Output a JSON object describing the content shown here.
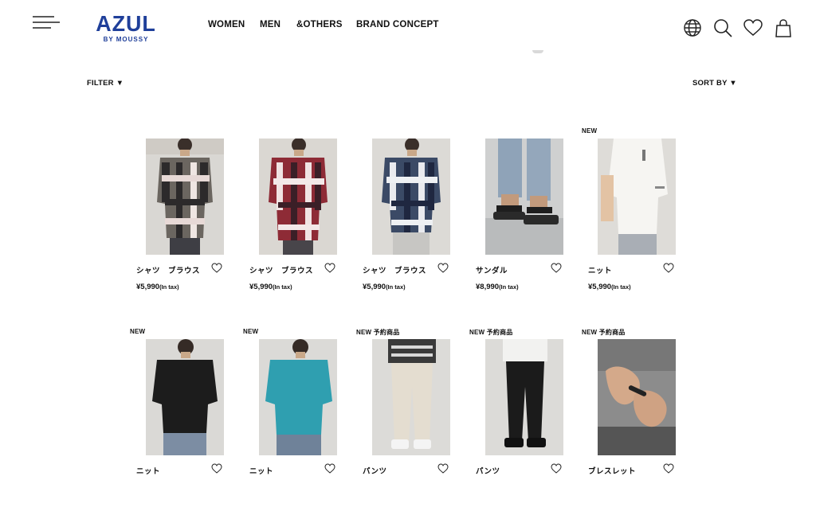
{
  "header": {
    "logo": {
      "main": "AZUL",
      "sub": "BY MOUSSY"
    },
    "nav": [
      "WOMEN",
      "MEN",
      "&OTHERS",
      "BRAND CONCEPT"
    ],
    "icons": [
      "menu-icon",
      "globe-icon",
      "search-icon",
      "heart-icon",
      "bag-icon"
    ]
  },
  "toolbar": {
    "filter_label": "FILTER ▼",
    "sort_label": "SORT BY ▼"
  },
  "products": [
    {
      "badge": "",
      "name": "シャツ　ブラウス",
      "price": "¥5,990",
      "tax": "(In tax)"
    },
    {
      "badge": "",
      "name": "シャツ　ブラウス",
      "price": "¥5,990",
      "tax": "(In tax)"
    },
    {
      "badge": "",
      "name": "シャツ　ブラウス",
      "price": "¥5,990",
      "tax": "(In tax)"
    },
    {
      "badge": "",
      "name": "サンダル",
      "price": "¥8,990",
      "tax": "(In tax)"
    },
    {
      "badge": "NEW",
      "name": "ニット",
      "price": "¥5,990",
      "tax": "(In tax)"
    },
    {
      "badge": "NEW",
      "name": "ニット",
      "price": "",
      "tax": ""
    },
    {
      "badge": "NEW",
      "name": "ニット",
      "price": "",
      "tax": ""
    },
    {
      "badge": "NEW  予約商品",
      "name": "パンツ",
      "price": "",
      "tax": ""
    },
    {
      "badge": "NEW  予約商品",
      "name": "パンツ",
      "price": "",
      "tax": ""
    },
    {
      "badge": "NEW  予約商品",
      "name": "ブレスレット",
      "price": "",
      "tax": ""
    }
  ]
}
